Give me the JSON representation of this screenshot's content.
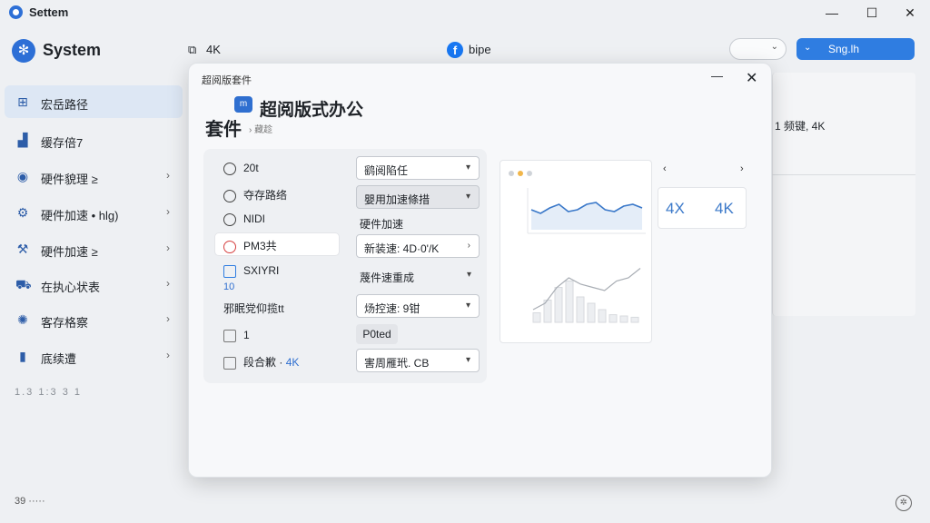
{
  "window": {
    "title": "Settem",
    "minimize": "—",
    "maximize": "☐",
    "close": "✕"
  },
  "header": {
    "app_name": "System",
    "resolution": "4K",
    "center_label": "bipe",
    "facebook_glyph": "f",
    "dropdown_value": "",
    "action_label": "Sng.lh"
  },
  "sidebar": {
    "items": [
      {
        "icon": "grid-icon",
        "label": "宏岳路径",
        "active": true,
        "arrow": ""
      },
      {
        "icon": "bar-chart-icon",
        "label": "缓存倍7",
        "active": false,
        "arrow": ""
      },
      {
        "icon": "circle-icon",
        "label": "硬件貌理 ≥",
        "active": false,
        "arrow": "›"
      },
      {
        "icon": "gear-icon",
        "label": "硬件加速 • hlg)",
        "active": false,
        "arrow": "›"
      },
      {
        "icon": "wrench-icon",
        "label": "硬件加速 ≥",
        "active": false,
        "arrow": "›"
      },
      {
        "icon": "car-icon",
        "label": "在执心状表",
        "active": false,
        "arrow": "›"
      },
      {
        "icon": "gears-icon",
        "label": "客存格察",
        "active": false,
        "arrow": "›"
      },
      {
        "icon": "document-icon",
        "label": "底续遭",
        "active": false,
        "arrow": "›"
      }
    ],
    "footer_1": "1.3 1:3 3 1",
    "footer_2": "39 ·····"
  },
  "background_panel": {
    "text": "1 频键, 4K"
  },
  "dialog": {
    "window_title": "超阅版套件",
    "heading": "超阅版式办公",
    "suite": "套件",
    "sub": "› 藏趁",
    "badge": "m",
    "options": {
      "radio_1": "20t",
      "radio_2": "夺存路络",
      "radio_3": "NIDI",
      "radio_4": "PM3共",
      "check_1": "SXIYRI",
      "check_1_sub": "10",
      "section_label": "邪眠党仰揽tt",
      "check_2": "1",
      "check_3_prefix": "段合歉 ·",
      "check_3_suffix": "4K"
    },
    "controls": {
      "select_1": "鹞阅陷任",
      "select_2": "嬰用加速條措",
      "label_hw": "硬件加速",
      "select_3": "新装速: 4D·0'/K",
      "label_4": "蔑件速重成",
      "select_5": "炀控速: 9钳",
      "pill": "P0ted",
      "select_6": "害周雁玳. CB"
    },
    "chart": {
      "nav_left": "‹",
      "nav_right": "›",
      "tile_1": "4X",
      "tile_2": "4K",
      "line_series": [
        0.45,
        0.55,
        0.4,
        0.3,
        0.5,
        0.45,
        0.3,
        0.25,
        0.45,
        0.5,
        0.35,
        0.3,
        0.4
      ],
      "bar_values": [
        0.15,
        0.35,
        0.55,
        0.65,
        0.4,
        0.3,
        0.2,
        0.12,
        0.1,
        0.08
      ],
      "trend_series": [
        0.2,
        0.3,
        0.55,
        0.7,
        0.6,
        0.55,
        0.5,
        0.65,
        0.7,
        0.85
      ]
    }
  }
}
